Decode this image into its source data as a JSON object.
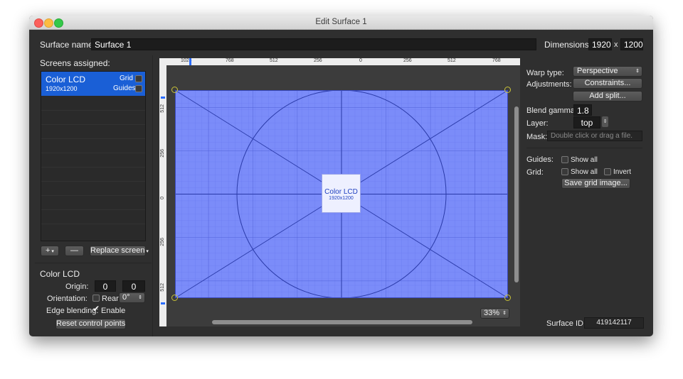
{
  "window": {
    "title": "Edit Surface 1"
  },
  "surface": {
    "name_label": "Surface name:",
    "name_value": "Surface 1",
    "dimensions_label": "Dimensions:",
    "width": "1920",
    "times": "x",
    "height": "1200"
  },
  "screens": {
    "header": "Screens assigned:",
    "items": [
      {
        "name": "Color LCD",
        "resolution": "1920x1200",
        "grid_label": "Grid",
        "guides_label": "Guides"
      }
    ],
    "add_button": "+",
    "remove_button": "—",
    "replace_button": "Replace screen"
  },
  "screen_props": {
    "title": "Color LCD",
    "origin_label": "Origin:",
    "origin_x": "0",
    "origin_y": "0",
    "orientation_label": "Orientation:",
    "rear_label": "Rear",
    "rotation": "0°",
    "edge_label": "Edge blending:",
    "enable_label": "Enable",
    "enable_checked": true,
    "reset_button": "Reset control points"
  },
  "canvas": {
    "top_ruler": [
      "1024",
      "768",
      "512",
      "256",
      "0",
      "256",
      "512",
      "768"
    ],
    "left_ruler": [
      "512",
      "256",
      "0",
      "256",
      "512"
    ],
    "screen_name": "Color LCD",
    "screen_res": "1920x1200",
    "zoom": "33%"
  },
  "right": {
    "warp_label": "Warp type:",
    "warp_value": "Perspective",
    "adjust_label": "Adjustments:",
    "constraints_button": "Constraints...",
    "add_split_button": "Add split...",
    "gamma_label": "Blend gamma:",
    "gamma_value": "1.8",
    "layer_label": "Layer:",
    "layer_value": "top",
    "mask_label": "Mask:",
    "mask_placeholder": "Double click or drag a file.",
    "guides_label": "Guides:",
    "guides_show_all": "Show all",
    "grid_label": "Grid:",
    "grid_show_all": "Show all",
    "grid_invert": "Invert",
    "save_grid_button": "Save grid image...",
    "surface_id_label": "Surface ID:",
    "surface_id_value": "419142117"
  },
  "colors": {
    "selection": "#1a5fd6",
    "canvas_blue": "#7b8cf9",
    "grid_line": "#5566d8",
    "background": "#2f2f2f"
  }
}
